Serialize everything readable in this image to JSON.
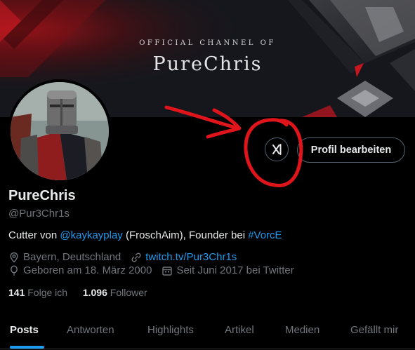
{
  "banner": {
    "subtitle": "OFFICIAL CHANNEL OF",
    "title": "PureChris"
  },
  "profile": {
    "display_name": "PureChris",
    "handle": "@Pur3Chr1s",
    "bio": {
      "prefix": "Cutter von ",
      "mention": "@kaykayplay",
      "middle": " (FroschAim), Founder bei ",
      "hashtag": "#VorcE"
    },
    "location": "Bayern, Deutschland",
    "website": "twitch.tv/Pur3Chr1s",
    "birthday": "Geboren am 18. März 2000",
    "joined": "Seit Juni 2017 bei Twitter",
    "following_count": "141",
    "following_label": "Folge ich",
    "followers_count": "1.096",
    "followers_label": "Follower"
  },
  "buttons": {
    "edit_profile": "Profil bearbeiten",
    "grok_icon": "grok-icon"
  },
  "tabs": [
    {
      "label": "Posts",
      "active": true
    },
    {
      "label": "Antworten",
      "active": false
    },
    {
      "label": "Highlights",
      "active": false
    },
    {
      "label": "Artikel",
      "active": false
    },
    {
      "label": "Medien",
      "active": false
    },
    {
      "label": "Gefällt mir",
      "active": false
    }
  ],
  "colors": {
    "background": "#000000",
    "accent": "#1d9bf0",
    "muted": "#71767b",
    "annotation": "#e0141b"
  }
}
